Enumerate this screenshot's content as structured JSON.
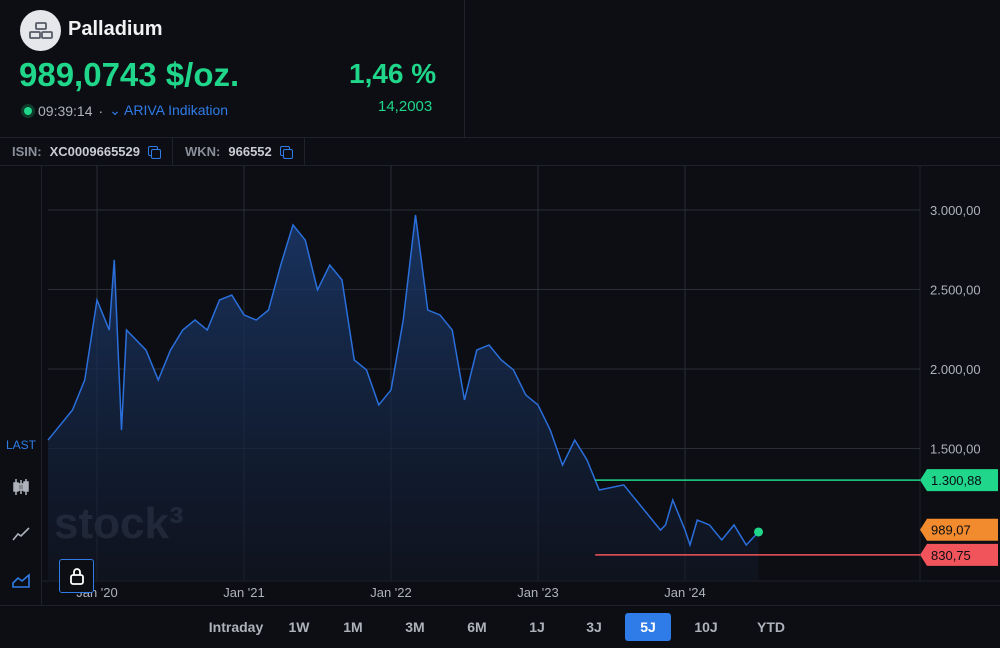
{
  "header": {
    "name": "Palladium",
    "price": "989,0743 $/oz.",
    "change_pct": "1,46 %",
    "change_abs": "14,2003",
    "time": "09:39:14",
    "separator": "·",
    "source": "ARIVA Indikation",
    "logo_icon": "metal-bars-icon"
  },
  "info": {
    "isin_label": "ISIN:",
    "isin": "XC0009665529",
    "wkn_label": "WKN:",
    "wkn": "966552"
  },
  "toolbar": {
    "last_label": "LAST",
    "tools": [
      "candlestick-icon",
      "line-chart-icon",
      "area-chart-icon"
    ],
    "lock_icon": "lock-icon"
  },
  "watermark": "stock³",
  "ranges": {
    "items": [
      "Intraday",
      "1W",
      "1M",
      "3M",
      "6M",
      "1J",
      "3J",
      "5J",
      "10J",
      "YTD"
    ],
    "active": "5J"
  },
  "colors": {
    "accent": "#2f7ce8",
    "up": "#1fd68a",
    "line": "#2a6fdb",
    "high": "#1fd68a",
    "low": "#f2545b",
    "last": "#f28a2e"
  },
  "chart_data": {
    "type": "area",
    "ylim": [
      600,
      3150
    ],
    "yticks": [
      {
        "v": 1500,
        "label": "1.500,00"
      },
      {
        "v": 2000,
        "label": "2.000,00"
      },
      {
        "v": 2500,
        "label": "2.500,00"
      },
      {
        "v": 3000,
        "label": "3.000,00"
      }
    ],
    "xticks": [
      {
        "d": "2020-01",
        "label": "Jan '20"
      },
      {
        "d": "2021-01",
        "label": "Jan '21"
      },
      {
        "d": "2022-01",
        "label": "Jan '22"
      },
      {
        "d": "2023-01",
        "label": "Jan '23"
      },
      {
        "d": "2024-01",
        "label": "Jan '24"
      }
    ],
    "xlim": [
      "2019-09",
      "2025-03"
    ],
    "grid": true,
    "markers": [
      {
        "name": "high",
        "value": 1300.88,
        "label": "1.300,88",
        "from": "2023-06"
      },
      {
        "name": "last",
        "value": 989.07,
        "label": "989,07"
      },
      {
        "name": "low",
        "value": 830.75,
        "label": "830,75",
        "from": "2023-06"
      }
    ],
    "points": [
      [
        "2019-09",
        1553
      ],
      [
        "2019-11",
        1742
      ],
      [
        "2019-12",
        1931
      ],
      [
        "2020-01",
        2434
      ],
      [
        "2020-02",
        2245
      ],
      [
        "2020-02",
        2686
      ],
      [
        "2020-03",
        1616
      ],
      [
        "2020-03",
        2245
      ],
      [
        "2020-05",
        2119
      ],
      [
        "2020-06",
        1931
      ],
      [
        "2020-07",
        2119
      ],
      [
        "2020-08",
        2245
      ],
      [
        "2020-09",
        2308
      ],
      [
        "2020-10",
        2245
      ],
      [
        "2020-11",
        2434
      ],
      [
        "2020-12",
        2465
      ],
      [
        "2021-01",
        2340
      ],
      [
        "2021-02",
        2308
      ],
      [
        "2021-03",
        2371
      ],
      [
        "2021-04",
        2654
      ],
      [
        "2021-05",
        2906
      ],
      [
        "2021-06",
        2811
      ],
      [
        "2021-07",
        2497
      ],
      [
        "2021-08",
        2654
      ],
      [
        "2021-09",
        2560
      ],
      [
        "2021-10",
        2057
      ],
      [
        "2021-11",
        1994
      ],
      [
        "2021-12",
        1774
      ],
      [
        "2022-01",
        1868
      ],
      [
        "2022-02",
        2308
      ],
      [
        "2022-03",
        2969
      ],
      [
        "2022-04",
        2371
      ],
      [
        "2022-05",
        2340
      ],
      [
        "2022-06",
        2245
      ],
      [
        "2022-07",
        1805
      ],
      [
        "2022-08",
        2119
      ],
      [
        "2022-09",
        2151
      ],
      [
        "2022-10",
        2057
      ],
      [
        "2022-11",
        1994
      ],
      [
        "2022-12",
        1837
      ],
      [
        "2023-01",
        1774
      ],
      [
        "2023-02",
        1616
      ],
      [
        "2023-03",
        1396
      ],
      [
        "2023-04",
        1553
      ],
      [
        "2023-05",
        1428
      ],
      [
        "2023-06",
        1239
      ],
      [
        "2023-08",
        1271
      ],
      [
        "2023-09",
        1176
      ],
      [
        "2023-11",
        987
      ],
      [
        "2023-11",
        1019
      ],
      [
        "2023-12",
        1176
      ],
      [
        "2024-01",
        987
      ],
      [
        "2024-01",
        893
      ],
      [
        "2024-02",
        1050
      ],
      [
        "2024-03",
        1019
      ],
      [
        "2024-04",
        925
      ],
      [
        "2024-05",
        1019
      ],
      [
        "2024-06",
        893
      ],
      [
        "2024-07",
        975
      ]
    ]
  }
}
